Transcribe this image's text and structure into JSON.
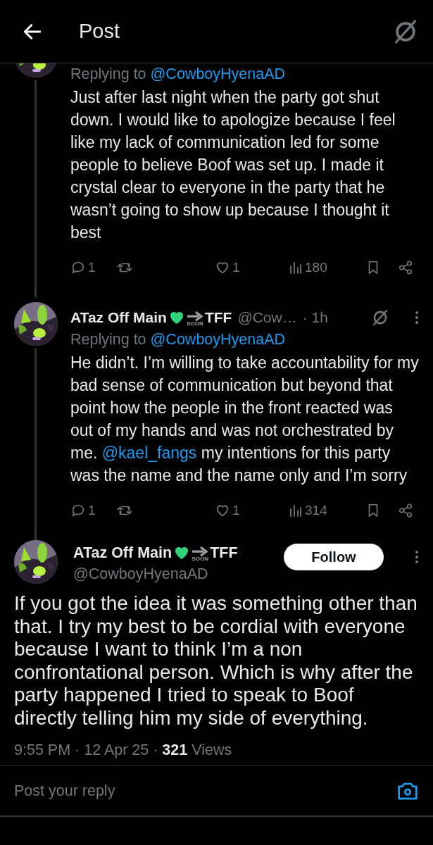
{
  "header": {
    "title": "Post"
  },
  "thread": [
    {
      "replying_prefix": "Replying to",
      "replying_handle": "@CowboyHyenaAD",
      "body": [
        {
          "kind": "text",
          "text": "Just after last night when the party got shut down. I would like to apologize because I feel like my lack of communication led for some people to believe Boof was set up. I made it crystal clear to everyone in the party that he wasn’t going to show up because I thought it best"
        }
      ],
      "stats": {
        "replies": "1",
        "likes": "1",
        "views": "180"
      }
    },
    {
      "author": {
        "name": "ATaz Off Main",
        "emoji_label": "SOON",
        "name_suffix": "TFF",
        "handle": "@Cow…",
        "time": "· 1h"
      },
      "replying_prefix": "Replying to",
      "replying_handle": "@CowboyHyenaAD",
      "body": [
        {
          "kind": "text",
          "text": "He didn’t. I’m willing to take accountability for my bad sense of communication but beyond that point how the people in the front reacted was out of my hands and was not orchestrated by me. "
        },
        {
          "kind": "mention",
          "text": "@kael_fangs"
        },
        {
          "kind": "text",
          "text": " my intentions for this party was the name and the name only and I’m sorry"
        }
      ],
      "stats": {
        "replies": "1",
        "likes": "1",
        "views": "314"
      }
    }
  ],
  "main_post": {
    "name": "ATaz Off Main",
    "emoji_label": "SOON",
    "name_suffix": "TFF",
    "handle": "@CowboyHyenaAD",
    "follow_label": "Follow",
    "body": "If you got the idea it was something other than that. I try my best to be cordial with everyone because I want to think I’m a non confrontational person. Which is why after the party happened I tried to speak to Boof directly telling him my side of everything.",
    "meta": "9:55 PM · 12 Apr 25 · **321** Views"
  },
  "composer": {
    "placeholder": "Post your reply"
  }
}
